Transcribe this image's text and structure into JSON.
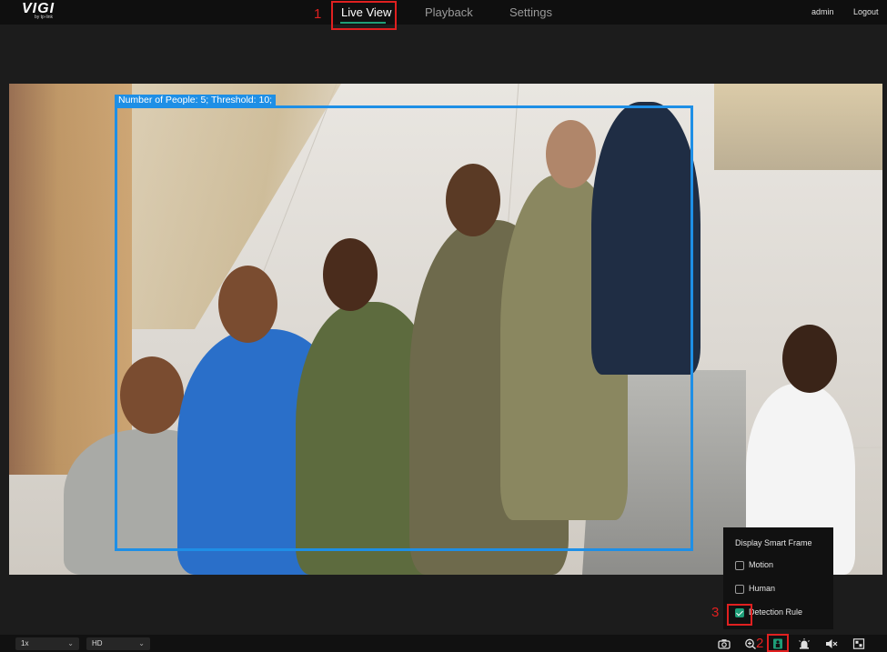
{
  "brand": {
    "logo_text": "VIGI",
    "logo_sub": "by tp-link"
  },
  "nav": {
    "items": [
      {
        "label": "Live View",
        "active": true
      },
      {
        "label": "Playback",
        "active": false
      },
      {
        "label": "Settings",
        "active": false
      }
    ]
  },
  "user": {
    "name": "admin",
    "logout_label": "Logout"
  },
  "annotations": {
    "step1": "1",
    "step2": "2",
    "step3": "3",
    "highlight_color": "#e02020"
  },
  "video": {
    "overlay_text": "Number of People: 5;   Threshold: 10;",
    "frame_color": "#1e8fe6"
  },
  "smart_frame_menu": {
    "title": "Display Smart Frame",
    "options": [
      {
        "label": "Motion",
        "checked": false
      },
      {
        "label": "Human",
        "checked": false
      },
      {
        "label": "Detection Rule",
        "checked": true
      }
    ]
  },
  "bottom_bar": {
    "speed_select": "1x",
    "quality_select": "HD",
    "icons": [
      "camera-snapshot-icon",
      "zoom-in-icon",
      "smart-frame-icon",
      "alarm-icon",
      "mute-icon",
      "fullscreen-icon"
    ]
  },
  "colors": {
    "accent": "#1e9e78",
    "background": "#1c1c1c",
    "topbar": "#0f0f0f"
  }
}
